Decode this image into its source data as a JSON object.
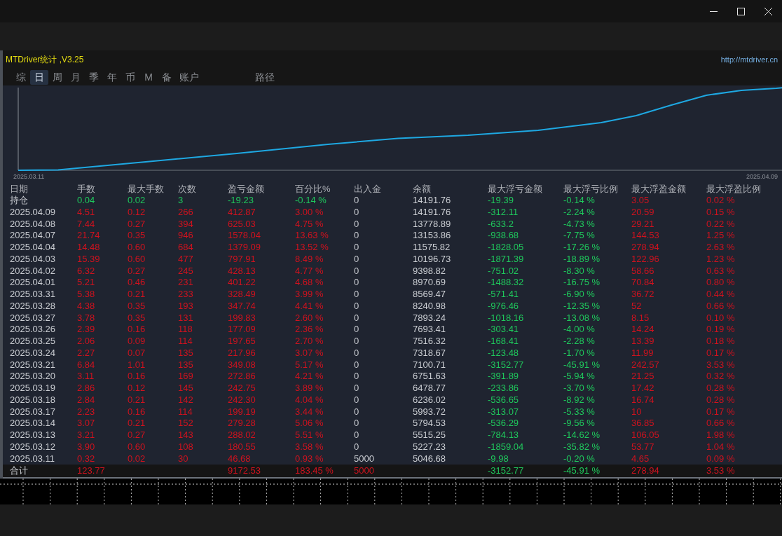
{
  "app": {
    "title": "MTDriver统计 ,V3.25",
    "link": "http://mtdriver.cn"
  },
  "tabs": [
    {
      "label": "综",
      "selected": false
    },
    {
      "label": "日",
      "selected": true
    },
    {
      "label": "周",
      "selected": false
    },
    {
      "label": "月",
      "selected": false
    },
    {
      "label": "季",
      "selected": false
    },
    {
      "label": "年",
      "selected": false
    },
    {
      "label": "币",
      "selected": false
    },
    {
      "label": "M",
      "selected": false
    },
    {
      "label": "备",
      "selected": false
    },
    {
      "label": "账户",
      "selected": false
    }
  ],
  "path_button": "路径",
  "equity_chart": {
    "start_label": "2025.03.11",
    "end_label": "2025.04.09"
  },
  "table": {
    "columns": [
      "日期",
      "手数",
      "最大手数",
      "次数",
      "盈亏金额",
      "百分比%",
      "出入金",
      "余额",
      "最大浮亏金额",
      "最大浮亏比例",
      "最大浮盈金额",
      "最大浮盈比例"
    ],
    "rows": [
      {
        "kind": "open",
        "cells": [
          "持仓",
          "0.04",
          "0.02",
          "3",
          "-19.23",
          "-0.14 %",
          "0",
          "14191.76",
          "-19.39",
          "-0.14 %",
          "3.05",
          "0.02 %"
        ]
      },
      {
        "kind": "day",
        "cells": [
          "2025.04.09",
          "4.51",
          "0.12",
          "266",
          "412.87",
          "3.00 %",
          "0",
          "14191.76",
          "-312.11",
          "-2.24 %",
          "20.59",
          "0.15 %"
        ]
      },
      {
        "kind": "day",
        "cells": [
          "2025.04.08",
          "7.44",
          "0.27",
          "394",
          "625.03",
          "4.75 %",
          "0",
          "13778.89",
          "-633.2",
          "-4.73 %",
          "29.21",
          "0.22 %"
        ]
      },
      {
        "kind": "day",
        "cells": [
          "2025.04.07",
          "21.74",
          "0.35",
          "946",
          "1578.04",
          "13.63 %",
          "0",
          "13153.86",
          "-938.68",
          "-7.75 %",
          "144.53",
          "1.25 %"
        ]
      },
      {
        "kind": "day",
        "cells": [
          "2025.04.04",
          "14.48",
          "0.60",
          "684",
          "1379.09",
          "13.52 %",
          "0",
          "11575.82",
          "-1828.05",
          "-17.26 %",
          "278.94",
          "2.63 %"
        ]
      },
      {
        "kind": "day",
        "cells": [
          "2025.04.03",
          "15.39",
          "0.60",
          "477",
          "797.91",
          "8.49 %",
          "0",
          "10196.73",
          "-1871.39",
          "-18.89 %",
          "122.96",
          "1.23 %"
        ]
      },
      {
        "kind": "day",
        "cells": [
          "2025.04.02",
          "6.32",
          "0.27",
          "245",
          "428.13",
          "4.77 %",
          "0",
          "9398.82",
          "-751.02",
          "-8.30 %",
          "58.66",
          "0.63 %"
        ]
      },
      {
        "kind": "day",
        "cells": [
          "2025.04.01",
          "5.21",
          "0.46",
          "231",
          "401.22",
          "4.68 %",
          "0",
          "8970.69",
          "-1488.32",
          "-16.75 %",
          "70.84",
          "0.80 %"
        ]
      },
      {
        "kind": "day",
        "cells": [
          "2025.03.31",
          "5.38",
          "0.21",
          "233",
          "328.49",
          "3.99 %",
          "0",
          "8569.47",
          "-571.41",
          "-6.90 %",
          "36.72",
          "0.44 %"
        ]
      },
      {
        "kind": "day",
        "cells": [
          "2025.03.28",
          "4.38",
          "0.35",
          "193",
          "347.74",
          "4.41 %",
          "0",
          "8240.98",
          "-976.46",
          "-12.35 %",
          "52",
          "0.66 %"
        ]
      },
      {
        "kind": "day",
        "cells": [
          "2025.03.27",
          "3.78",
          "0.35",
          "131",
          "199.83",
          "2.60 %",
          "0",
          "7893.24",
          "-1018.16",
          "-13.08 %",
          "8.15",
          "0.10 %"
        ]
      },
      {
        "kind": "day",
        "cells": [
          "2025.03.26",
          "2.39",
          "0.16",
          "118",
          "177.09",
          "2.36 %",
          "0",
          "7693.41",
          "-303.41",
          "-4.00 %",
          "14.24",
          "0.19 %"
        ]
      },
      {
        "kind": "day",
        "cells": [
          "2025.03.25",
          "2.06",
          "0.09",
          "114",
          "197.65",
          "2.70 %",
          "0",
          "7516.32",
          "-168.41",
          "-2.28 %",
          "13.39",
          "0.18 %"
        ]
      },
      {
        "kind": "day",
        "cells": [
          "2025.03.24",
          "2.27",
          "0.07",
          "135",
          "217.96",
          "3.07 %",
          "0",
          "7318.67",
          "-123.48",
          "-1.70 %",
          "11.99",
          "0.17 %"
        ]
      },
      {
        "kind": "day",
        "cells": [
          "2025.03.21",
          "6.84",
          "1.01",
          "135",
          "349.08",
          "5.17 %",
          "0",
          "7100.71",
          "-3152.77",
          "-45.91 %",
          "242.57",
          "3.53 %"
        ]
      },
      {
        "kind": "day",
        "cells": [
          "2025.03.20",
          "3.11",
          "0.16",
          "169",
          "272.86",
          "4.21 %",
          "0",
          "6751.63",
          "-391.89",
          "-5.94 %",
          "21.25",
          "0.32 %"
        ]
      },
      {
        "kind": "day",
        "cells": [
          "2025.03.19",
          "2.86",
          "0.12",
          "145",
          "242.75",
          "3.89 %",
          "0",
          "6478.77",
          "-233.86",
          "-3.70 %",
          "17.42",
          "0.28 %"
        ]
      },
      {
        "kind": "day",
        "cells": [
          "2025.03.18",
          "2.84",
          "0.21",
          "142",
          "242.30",
          "4.04 %",
          "0",
          "6236.02",
          "-536.65",
          "-8.92 %",
          "16.74",
          "0.28 %"
        ]
      },
      {
        "kind": "day",
        "cells": [
          "2025.03.17",
          "2.23",
          "0.16",
          "114",
          "199.19",
          "3.44 %",
          "0",
          "5993.72",
          "-313.07",
          "-5.33 %",
          "10",
          "0.17 %"
        ]
      },
      {
        "kind": "day",
        "cells": [
          "2025.03.14",
          "3.07",
          "0.21",
          "152",
          "279.28",
          "5.06 %",
          "0",
          "5794.53",
          "-536.29",
          "-9.56 %",
          "36.85",
          "0.66 %"
        ]
      },
      {
        "kind": "day",
        "cells": [
          "2025.03.13",
          "3.21",
          "0.27",
          "143",
          "288.02",
          "5.51 %",
          "0",
          "5515.25",
          "-784.13",
          "-14.62 %",
          "106.05",
          "1.98 %"
        ]
      },
      {
        "kind": "day",
        "cells": [
          "2025.03.12",
          "3.90",
          "0.60",
          "108",
          "180.55",
          "3.58 %",
          "0",
          "5227.23",
          "-1859.04",
          "-35.82 %",
          "53.77",
          "1.04 %"
        ]
      },
      {
        "kind": "day",
        "cells": [
          "2025.03.11",
          "0.32",
          "0.02",
          "30",
          "46.68",
          "0.93 %",
          "5000",
          "5046.68",
          "-9.98",
          "-0.20 %",
          "4.65",
          "0.09 %"
        ]
      },
      {
        "kind": "total",
        "cells": [
          "合计",
          "123.77",
          null,
          null,
          "9172.53",
          "183.45 %",
          "5000",
          null,
          "-3152.77",
          "-45.91 %",
          "278.94",
          "3.53 %"
        ]
      }
    ]
  }
}
